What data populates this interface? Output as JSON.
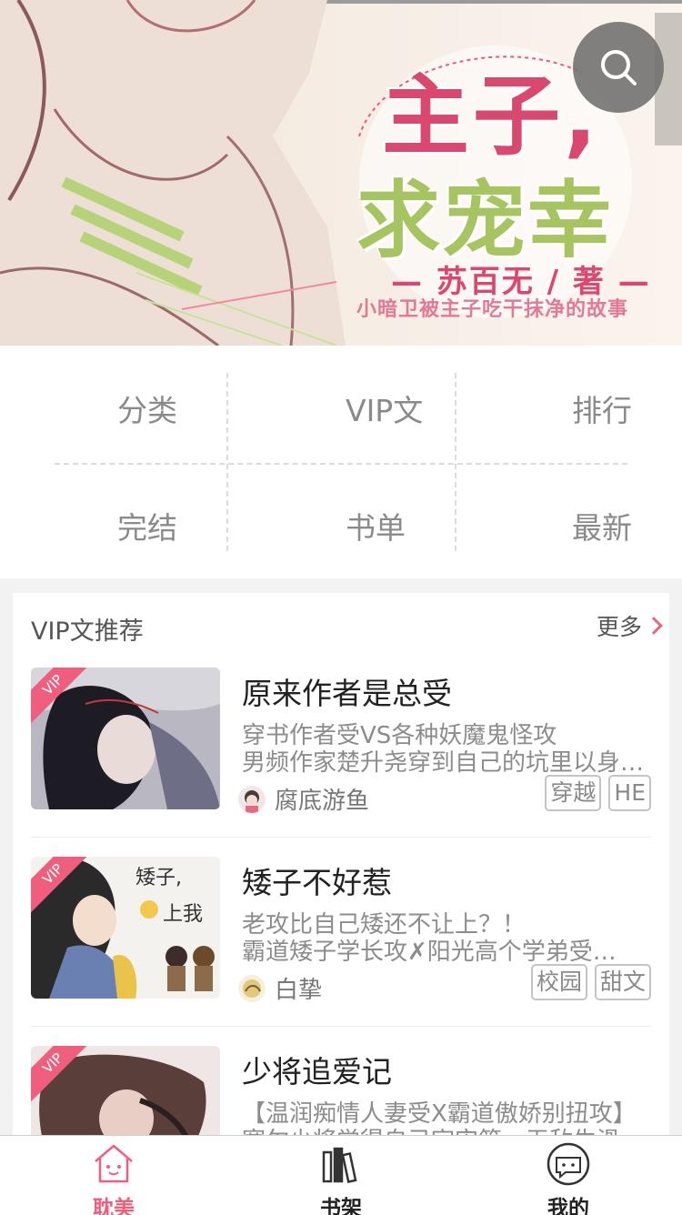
{
  "banner": {
    "title_line1": "主子,",
    "title_line2": "求宠幸",
    "author": "— 苏百无 / 著 —",
    "subtitle": "小暗卫被主子吃干抹净的故事"
  },
  "search": {
    "icon": "search-icon"
  },
  "categories": [
    {
      "label": "分类"
    },
    {
      "label": "VIP文"
    },
    {
      "label": "排行"
    },
    {
      "label": "完结"
    },
    {
      "label": "书单"
    },
    {
      "label": "最新"
    }
  ],
  "vip_section": {
    "title": "VIP文推荐",
    "more": "更多",
    "books": [
      {
        "badge": "VIP",
        "title": "原来作者是总受",
        "desc1": "穿书作者受VS各种妖魔鬼怪攻",
        "desc2": "男频作家楚升尧穿到自己的坑里以身…",
        "author": "腐底游鱼",
        "tags": [
          "穿越",
          "HE"
        ]
      },
      {
        "badge": "VIP",
        "title": "矮子不好惹",
        "desc1": "老攻比自己矮还不让上？！",
        "desc2": "霸道矮子学长攻✗阳光高个学弟受…",
        "author": "白挚",
        "tags": [
          "校园",
          "甜文"
        ]
      },
      {
        "badge": "VIP",
        "title": "少将追爱记",
        "desc1": "【温润痴情人妻受X霸道傲娇别扭攻】",
        "desc2": "塞尔少将觉得自己宇宙第一无敌生滑",
        "author": "",
        "tags": []
      }
    ]
  },
  "bottom_nav": [
    {
      "label": "耽美",
      "icon": "home-icon",
      "active": true
    },
    {
      "label": "书架",
      "icon": "bookshelf-icon",
      "active": false
    },
    {
      "label": "我的",
      "icon": "profile-icon",
      "active": false
    }
  ],
  "colors": {
    "accent": "#ef5f7d",
    "text_gray": "#8a8a8a"
  }
}
